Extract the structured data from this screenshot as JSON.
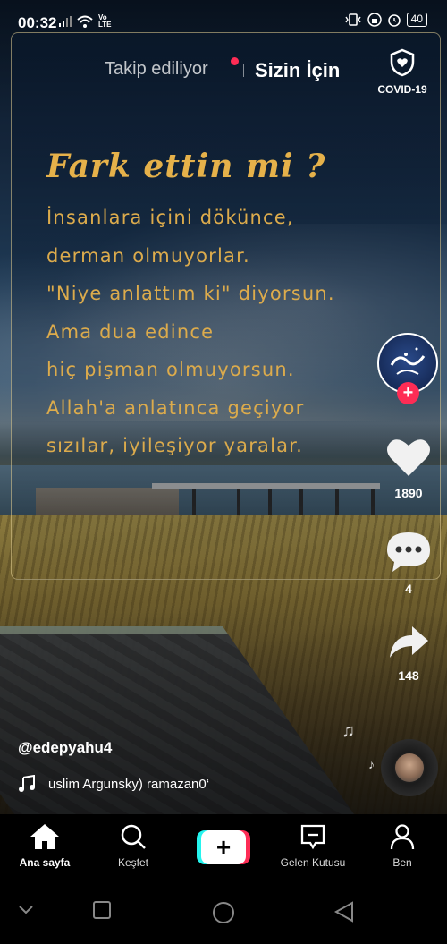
{
  "status_bar": {
    "time": "00:32",
    "volte": "Vo LTE",
    "battery": "40"
  },
  "top_tabs": {
    "following": "Takip ediliyor",
    "for_you": "Sizin İçin"
  },
  "covid": {
    "label": "COVID-19"
  },
  "quote": {
    "title": "Fark ettin mi ?",
    "lines": [
      "İnsanlara içini dökünce,",
      "derman olmuyorlar.",
      "\"Niye anlattım ki\" diyorsun.",
      "Ama dua edince",
      "hiç pişman olmuyorsun.",
      "Allah'a anlatınca geçiyor",
      "sızılar, iyileşiyor yaralar."
    ]
  },
  "actions": {
    "likes": "1890",
    "comments": "4",
    "shares": "148"
  },
  "caption": {
    "username": "@edepyahu4",
    "music": "uslim Argunsky)   ramazan0‘"
  },
  "bottom_nav": {
    "home": "Ana sayfa",
    "discover": "Keşfet",
    "inbox": "Gelen Kutusu",
    "profile": "Ben"
  },
  "colors": {
    "accent_red": "#fe2c55",
    "accent_cyan": "#25f4ee",
    "quote_gold": "#dcab4c"
  }
}
